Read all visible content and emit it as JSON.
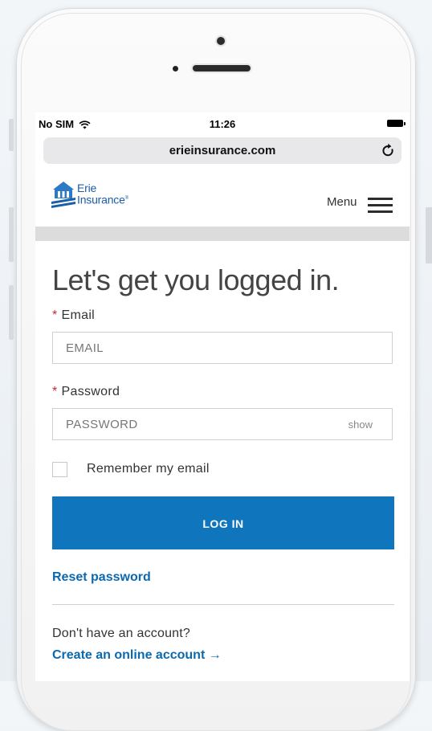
{
  "status_bar": {
    "carrier": "No SIM",
    "time": "11:26"
  },
  "browser": {
    "url": "erieinsurance.com"
  },
  "header": {
    "logo_line1": "Erie",
    "logo_line2": "Insurance",
    "logo_mark": "®",
    "menu_label": "Menu"
  },
  "login": {
    "title": "Let's get you logged in.",
    "required_marker": "*",
    "email_label": "Email",
    "email_placeholder": "EMAIL",
    "password_label": "Password",
    "password_placeholder": "PASSWORD",
    "show_label": "show",
    "remember_label": "Remember my email",
    "login_button": "LOG IN",
    "reset_link": "Reset password",
    "no_account_text": "Don't have an account?",
    "create_link": "Create an online account",
    "create_arrow": "→"
  },
  "colors": {
    "brand_blue": "#0f75bc",
    "link_blue": "#0b69b0",
    "logo_blue": "#1b5ea8",
    "required_red": "#c62828"
  },
  "icons": [
    "wifi-icon",
    "battery-icon",
    "reload-icon",
    "erie-logo-icon",
    "hamburger-menu-icon",
    "checkbox-icon"
  ]
}
